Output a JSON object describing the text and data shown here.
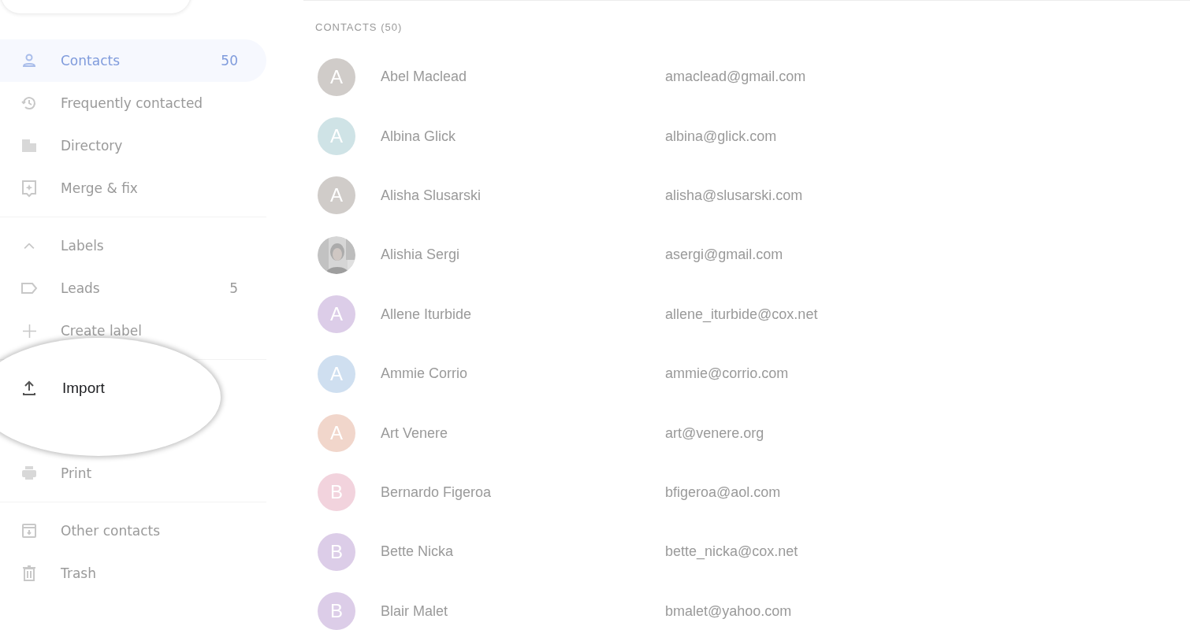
{
  "sidebar": {
    "items": [
      {
        "kind": "item",
        "label": "Contacts",
        "count": "50",
        "selected": true
      },
      {
        "kind": "item",
        "label": "Frequently contacted",
        "selected": false
      },
      {
        "kind": "item",
        "label": "Directory",
        "selected": false
      },
      {
        "kind": "item",
        "label": "Merge & fix",
        "selected": false
      },
      {
        "kind": "divider"
      },
      {
        "kind": "item",
        "label": "Labels",
        "selected": false
      },
      {
        "kind": "item",
        "label": "Leads",
        "count": "5",
        "selected": false
      },
      {
        "kind": "item",
        "label": "Create label",
        "selected": false
      },
      {
        "kind": "divider"
      },
      {
        "kind": "spotlight",
        "label": "Import"
      },
      {
        "kind": "item",
        "label": "Print",
        "selected": false
      },
      {
        "kind": "divider"
      },
      {
        "kind": "item",
        "label": "Other contacts",
        "selected": false
      },
      {
        "kind": "item",
        "label": "Trash",
        "selected": false
      }
    ]
  },
  "list": {
    "heading": "CONTACTS (50)",
    "contacts": [
      {
        "initial": "A",
        "color": "#d0ccc9",
        "name": "Abel Maclead",
        "email": "amaclead@gmail.com"
      },
      {
        "initial": "A",
        "color": "#cfe3e6",
        "name": "Albina Glick",
        "email": "albina@glick.com"
      },
      {
        "initial": "A",
        "color": "#d0ccc9",
        "name": "Alisha Slusarski",
        "email": "alisha@slusarski.com"
      },
      {
        "kind": "picture",
        "name": "Alishia Sergi",
        "email": "asergi@gmail.com"
      },
      {
        "initial": "A",
        "color": "#dccde8",
        "name": "Allene Iturbide",
        "email": "allene_iturbide@cox.net"
      },
      {
        "initial": "A",
        "color": "#cfdff0",
        "name": "Ammie Corrio",
        "email": "ammie@corrio.com"
      },
      {
        "initial": "A",
        "color": "#f1d6cb",
        "name": "Art Venere",
        "email": "art@venere.org"
      },
      {
        "initial": "B",
        "color": "#f2d3dd",
        "name": "Bernardo Figeroa",
        "email": "bfigeroa@aol.com"
      },
      {
        "initial": "B",
        "color": "#dccde8",
        "name": "Bette Nicka",
        "email": "bette_nicka@cox.net"
      },
      {
        "initial": "B",
        "color": "#dccde8",
        "name": "Blair Malet",
        "email": "bmalet@yahoo.com"
      }
    ]
  }
}
